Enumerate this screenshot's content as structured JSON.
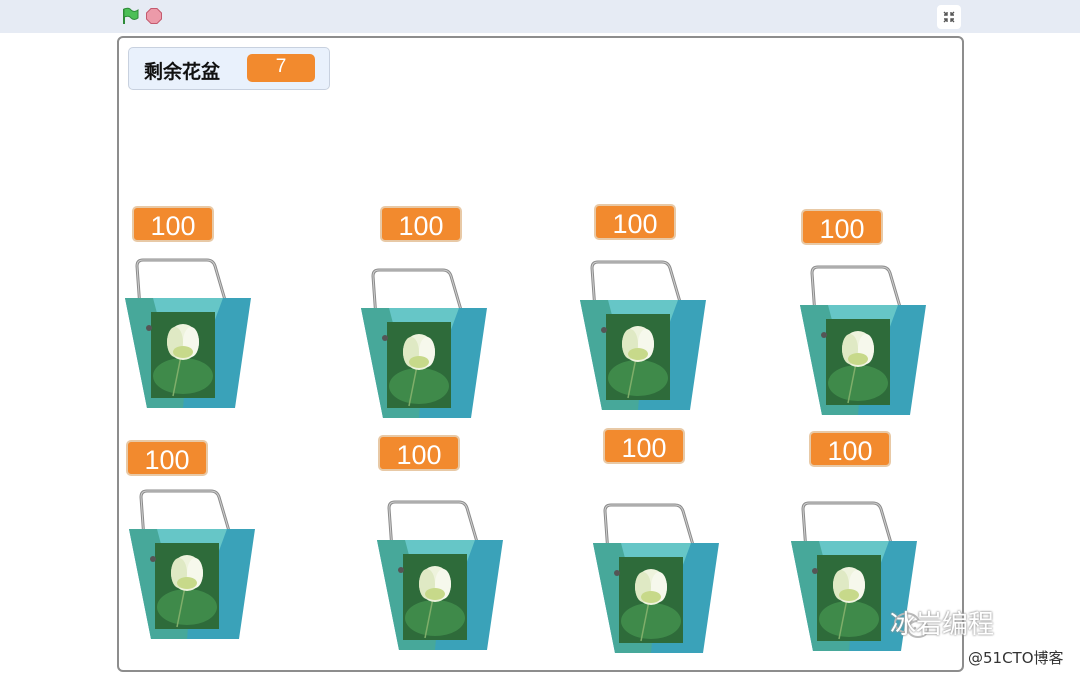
{
  "toolbar": {
    "flag_icon": "green-flag-icon",
    "stop_icon": "stop-sign-icon",
    "fullscreen_icon": "exit-fullscreen-icon",
    "colors": {
      "flag": "#4cbf56",
      "stop": "#ec9aa9",
      "bar": "#e6ebf4"
    }
  },
  "stage": {
    "monitor": {
      "label": "剩余花盆",
      "value": "7"
    },
    "sprites": [
      {
        "bubble": "100"
      },
      {
        "bubble": "100"
      },
      {
        "bubble": "100"
      },
      {
        "bubble": "100"
      },
      {
        "bubble": "100"
      },
      {
        "bubble": "100"
      },
      {
        "bubble": "100"
      },
      {
        "bubble": "100"
      }
    ],
    "colors": {
      "bubble": "#f28a2e",
      "pot_light": "#66c6c7",
      "pot_dark": "#3aa2b9",
      "pot_mid": "#47a89a"
    }
  },
  "watermark": {
    "text": "冰岩编程",
    "icon": "wechat-icon"
  },
  "copyright": "@51CTO博客"
}
